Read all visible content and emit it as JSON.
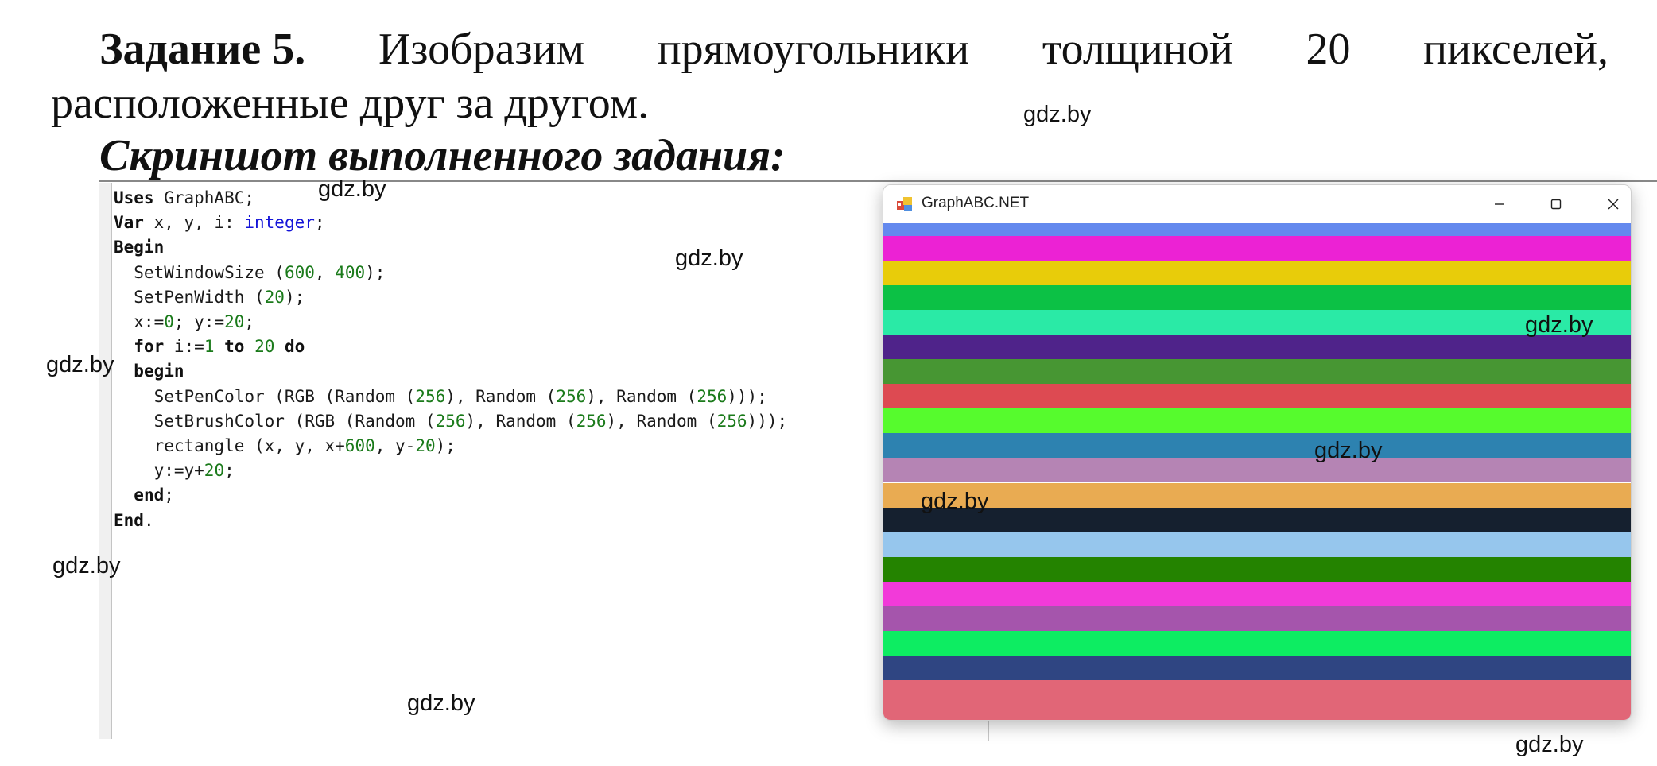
{
  "task": {
    "label": "Задание 5.",
    "line1_words": [
      "Изобразим",
      "прямоугольники",
      "толщиной",
      "20",
      "пикселей,"
    ],
    "line2": "расположенные друг за другом.",
    "heading": "Скриншот выполненного задания:"
  },
  "code_lines": [
    [
      {
        "t": "Uses",
        "c": "kw"
      },
      {
        "t": " GraphABC;",
        "c": ""
      }
    ],
    [
      {
        "t": "Var",
        "c": "kw"
      },
      {
        "t": " x, y, i: ",
        "c": ""
      },
      {
        "t": "integer",
        "c": "ty"
      },
      {
        "t": ";",
        "c": ""
      }
    ],
    [
      {
        "t": "Begin",
        "c": "kw"
      }
    ],
    [
      {
        "t": "  SetWindowSize (",
        "c": ""
      },
      {
        "t": "600",
        "c": "nm"
      },
      {
        "t": ", ",
        "c": ""
      },
      {
        "t": "400",
        "c": "nm"
      },
      {
        "t": ");",
        "c": ""
      }
    ],
    [
      {
        "t": "  SetPenWidth (",
        "c": ""
      },
      {
        "t": "20",
        "c": "nm"
      },
      {
        "t": ");",
        "c": ""
      }
    ],
    [
      {
        "t": "  x:=",
        "c": ""
      },
      {
        "t": "0",
        "c": "nm"
      },
      {
        "t": "; y:=",
        "c": ""
      },
      {
        "t": "20",
        "c": "nm"
      },
      {
        "t": ";",
        "c": ""
      }
    ],
    [
      {
        "t": "  ",
        "c": ""
      },
      {
        "t": "for",
        "c": "kw"
      },
      {
        "t": " i:=",
        "c": ""
      },
      {
        "t": "1",
        "c": "nm"
      },
      {
        "t": " ",
        "c": ""
      },
      {
        "t": "to",
        "c": "kw"
      },
      {
        "t": " ",
        "c": ""
      },
      {
        "t": "20",
        "c": "nm"
      },
      {
        "t": " ",
        "c": ""
      },
      {
        "t": "do",
        "c": "kw"
      }
    ],
    [
      {
        "t": "  ",
        "c": ""
      },
      {
        "t": "begin",
        "c": "kw"
      }
    ],
    [
      {
        "t": "    SetPenColor (RGB (Random (",
        "c": ""
      },
      {
        "t": "256",
        "c": "nm"
      },
      {
        "t": "), Random (",
        "c": ""
      },
      {
        "t": "256",
        "c": "nm"
      },
      {
        "t": "), Random (",
        "c": ""
      },
      {
        "t": "256",
        "c": "nm"
      },
      {
        "t": ")));",
        "c": ""
      }
    ],
    [
      {
        "t": "    SetBrushColor (RGB (Random (",
        "c": ""
      },
      {
        "t": "256",
        "c": "nm"
      },
      {
        "t": "), Random (",
        "c": ""
      },
      {
        "t": "256",
        "c": "nm"
      },
      {
        "t": "), Random (",
        "c": ""
      },
      {
        "t": "256",
        "c": "nm"
      },
      {
        "t": ")));",
        "c": ""
      }
    ],
    [
      {
        "t": "    rectangle (x, y, x+",
        "c": ""
      },
      {
        "t": "600",
        "c": "nm"
      },
      {
        "t": ", y-",
        "c": ""
      },
      {
        "t": "20",
        "c": "nm"
      },
      {
        "t": ");",
        "c": ""
      }
    ],
    [
      {
        "t": "    y:=y+",
        "c": ""
      },
      {
        "t": "20",
        "c": "nm"
      },
      {
        "t": ";",
        "c": ""
      }
    ],
    [
      {
        "t": "  ",
        "c": ""
      },
      {
        "t": "end",
        "c": "kw"
      },
      {
        "t": ";",
        "c": ""
      }
    ],
    [
      {
        "t": "End",
        "c": "kw"
      },
      {
        "t": ".",
        "c": ""
      }
    ]
  ],
  "graph_window": {
    "title": "GraphABC.NET",
    "minimize_symbol": "—",
    "maximize_symbol": "☐",
    "close_symbol": "✕",
    "stripe_colors": [
      "#6489ee",
      "#ec22d4",
      "#e8cc0a",
      "#0cc145",
      "#2aeaa6",
      "#4f238a",
      "#479633",
      "#dd4a52",
      "#56fb2d",
      "#2d82b0",
      "#b584b4",
      "#e9ab52",
      "#15202f",
      "#96c6ed",
      "#248300",
      "#f23ad9",
      "#a555ac",
      "#0ded62",
      "#2f4582",
      "#e16677"
    ]
  },
  "watermarks": [
    {
      "id": "wm-1",
      "text": "gdz.by"
    },
    {
      "id": "wm-2",
      "text": "gdz.by"
    },
    {
      "id": "wm-3",
      "text": "gdz.by"
    },
    {
      "id": "wm-4",
      "text": "gdz.by"
    },
    {
      "id": "wm-5",
      "text": "gdz.by"
    },
    {
      "id": "wm-6",
      "text": "gdz.by"
    },
    {
      "id": "wm-7",
      "text": "gdz.by"
    },
    {
      "id": "wm-8",
      "text": "gdz.by"
    },
    {
      "id": "wm-9",
      "text": "gdz.by"
    },
    {
      "id": "wm-10",
      "text": "gdz.by"
    }
  ]
}
